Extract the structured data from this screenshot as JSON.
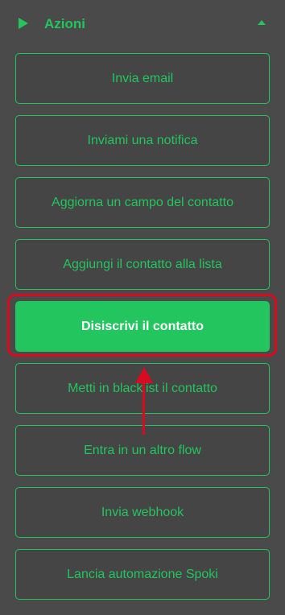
{
  "section": {
    "title": "Azioni",
    "accent_color": "#22c55e",
    "icons": {
      "left": "play-icon",
      "right": "chevron-up-icon"
    }
  },
  "actions": [
    {
      "label": "Invia email"
    },
    {
      "label": "Inviami una notifica"
    },
    {
      "label": "Aggiorna un campo del contatto"
    },
    {
      "label": "Aggiungi il contatto alla lista"
    },
    {
      "label": "Disiscrivi il contatto",
      "selected": true
    },
    {
      "label": "Metti in blacklist il contatto"
    },
    {
      "label": "Entra in un altro flow"
    },
    {
      "label": "Invia webhook"
    },
    {
      "label": "Lancia automazione Spoki"
    }
  ],
  "annotation": {
    "color": "#d90b1f"
  }
}
